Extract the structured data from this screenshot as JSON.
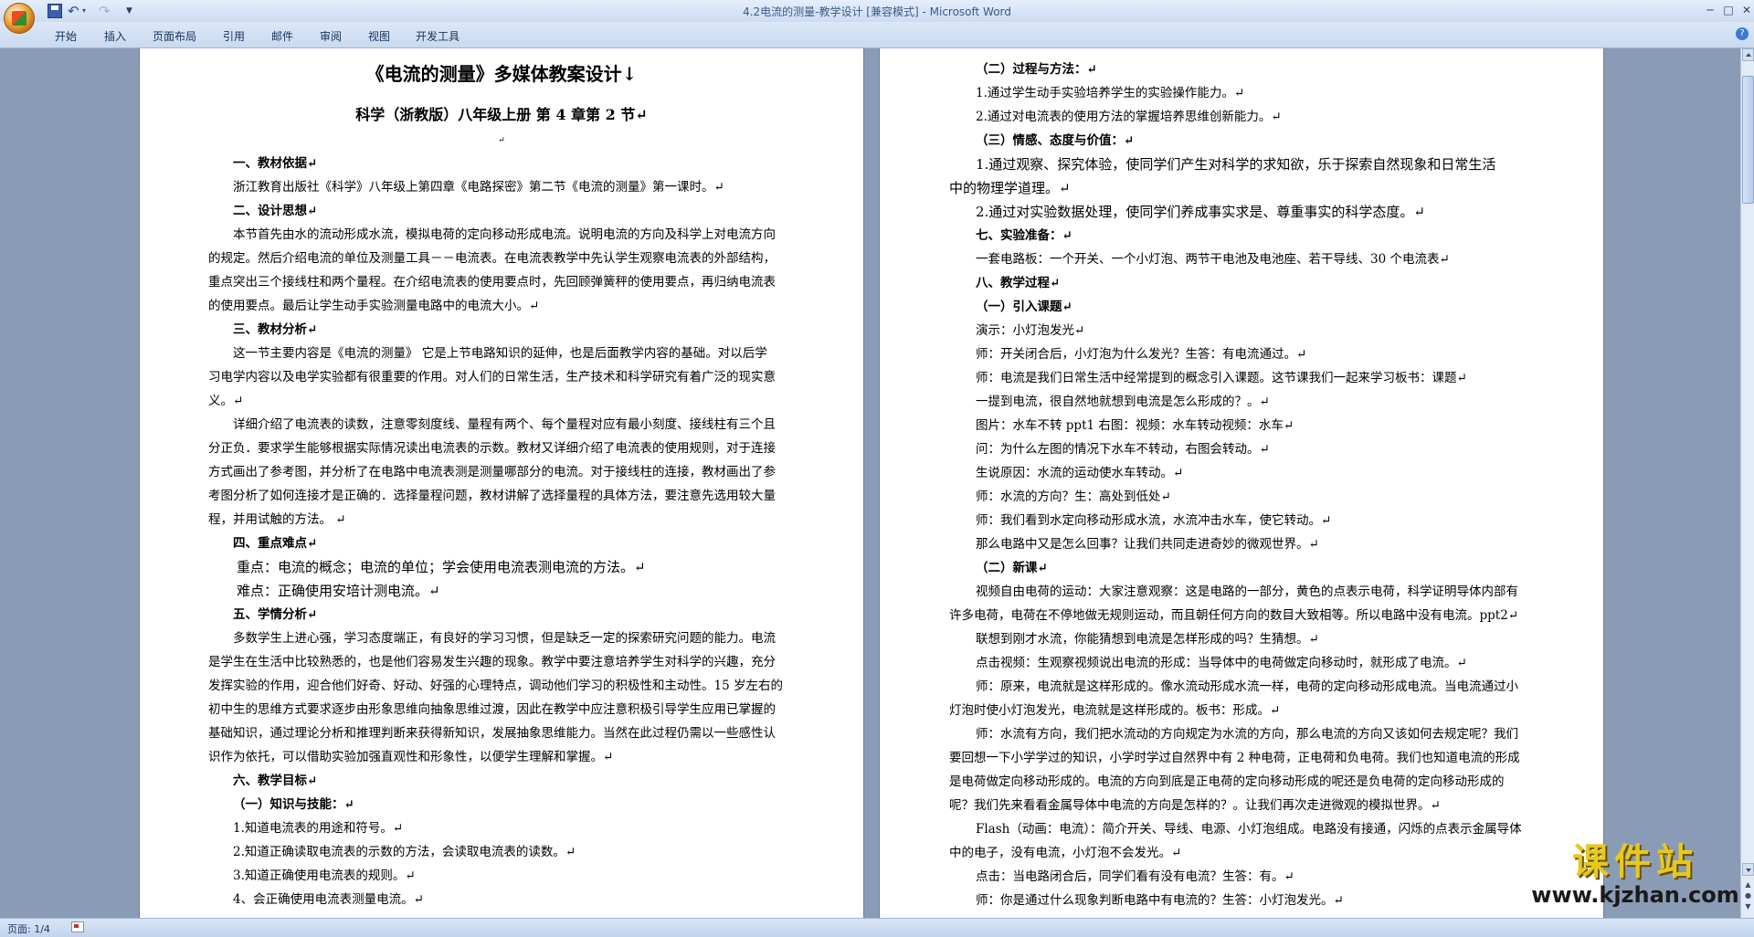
{
  "window": {
    "title": "4.2电流的测量-教学设计 [兼容模式] - Microsoft Word",
    "quick_access": {
      "save": "save-icon",
      "undo": "↶",
      "undo_drop": "▾",
      "redo": "↷",
      "customize": "▼"
    },
    "controls": {
      "minimize": "─",
      "maximize": "□",
      "close": "✕"
    }
  },
  "ribbon": {
    "tabs": [
      "开始",
      "插入",
      "页面布局",
      "引用",
      "邮件",
      "审阅",
      "视图",
      "开发工具"
    ],
    "help": "?"
  },
  "document": {
    "page1": {
      "title": "《电流的测量》多媒体教案设计↓",
      "subtitle": "科学（浙教版）八年级上册  第 4 章第 2 节↵",
      "mark": "↵",
      "s1_head": "一、教材依据↵",
      "s1_l1": "浙江教育出版社《科学》八年级上第四章《电路探密》第二节《电流的测量》第一课时。↵",
      "s2_head": "二、设计思想↵",
      "s2_l1": "本节首先由水的流动形成水流，模拟电荷的定向移动形成电流。说明电流的方向及科学上对电流方向",
      "s2_l2": "的规定。然后介绍电流的单位及测量工具－－电流表。在电流表教学中先认学生观察电流表的外部结构，",
      "s2_l3": "重点突出三个接线柱和两个量程。在介绍电流表的使用要点时，先回顾弹簧秤的使用要点，再归纳电流表",
      "s2_l4": "的使用要点。最后让学生动手实验测量电路中的电流大小。↵",
      "s3_head": "三、教材分析↵",
      "s3_l1": "这一节主要内容是《电流的测量》 它是上节电路知识的延伸，也是后面教学内容的基础。对以后学",
      "s3_l2": "习电学内容以及电学实验都有很重要的作用。对人们的日常生活，生产技术和科学研究有着广泛的现实意",
      "s3_l3": "义。↵",
      "s3_l4": "详细介绍了电流表的读数，注意零刻度线、量程有两个、每个量程对应有最小刻度、接线柱有三个且",
      "s3_l5": "分正负．要求学生能够根据实际情况读出电流表的示数。教材又详细介绍了电流表的使用规则，对于连接",
      "s3_l6": "方式画出了参考图，并分析了在电路中电流表测是测量哪部分的电流。对于接线柱的连接，教材画出了参",
      "s3_l7": "考图分析了如何连接才是正确的．选择量程问题，教材讲解了选择量程的具体方法，要注意先选用较大量",
      "s3_l8": "程，并用试触的方法。 ↵",
      "s4_head": "四、重点难点↵",
      "s4_l1": "重点：电流的概念；电流的单位；学会使用电流表测电流的方法。↵",
      "s4_l2": "难点：正确使用安培计测电流。↵",
      "s5_head": "五、学情分析↵",
      "s5_l1": "多数学生上进心强，学习态度端正，有良好的学习习惯，但是缺乏一定的探索研究问题的能力。电流",
      "s5_l2": "是学生在生活中比较熟悉的，也是他们容易发生兴趣的现象。教学中要注意培养学生对科学的兴趣，充分",
      "s5_l3": "发挥实验的作用，迎合他们好奇、好动、好强的心理特点，调动他们学习的积极性和主动性。15 岁左右的",
      "s5_l4": "初中生的思维方式要求逐步由形象思维向抽象思维过渡，因此在教学中应注意积极引导学生应用已掌握的",
      "s5_l5": "基础知识，通过理论分析和推理判断来获得新知识，发展抽象思维能力。当然在此过程仍需以一些感性认",
      "s5_l6": "识作为依托，可以借助实验加强直观性和形象性，以便学生理解和掌握。↵",
      "s6_head": "六、教学目标↵",
      "s6_sub": "（一）知识与技能：↵",
      "s6_l1": "1.知道电流表的用途和符号。↵",
      "s6_l2": "2.知道正确读取电流表的示数的方法，会读取电流表的读数。↵",
      "s6_l3": "3.知道正确使用电流表的规则。↵",
      "s6_l4": "4、会正确使用电流表测量电流。↵"
    },
    "page2": {
      "g2_head": "（二）过程与方法：↵",
      "g2_l1": "1.通过学生动手实验培养学生的实验操作能力。↵",
      "g2_l2": "2.通过对电流表的使用方法的掌握培养思维创新能力。↵",
      "g3_head": "（三）情感、态度与价值：↵",
      "g3_l1": "1.通过观察、探究体验，使同学们产生对科学的求知欲，乐于探索自然现象和日常生活",
      "g3_l2": "中的物理学道理。↵",
      "g3_l3": "2.通过对实验数据处理，使同学们养成事实求是、尊重事实的科学态度。↵",
      "s7_head": "七、实验准备：↵",
      "s7_l1": "一套电路板：一个开关、一个小灯泡、两节干电池及电池座、若干导线、30 个电流表↵",
      "s8_head": "八、教学过程↵",
      "s8_sub1": "（一）引入课题↵",
      "p1": "演示：小灯泡发光↵",
      "p2": "师：开关闭合后，小灯泡为什么发光？生答：有电流通过。↵",
      "p3": "师：电流是我们日常生活中经常提到的概念引入课题。这节课我们一起来学习板书：课题↵",
      "p4": "一提到电流，很自然地就想到电流是怎么形成的？。↵",
      "p5": "图片：水车不转 ppt1     右图：视频：水车转动视频：水车↵",
      "p6": "问：为什么左图的情况下水车不转动，右图会转动。↵",
      "p7": "生说原因：水流的运动使水车转动。↵",
      "p8": "师：水流的方向？生：高处到低处↵",
      "p9": "师：我们看到水定向移动形成水流，水流冲击水车，使它转动。↵",
      "p10": "那么电路中又是怎么回事？让我们共同走进奇妙的微观世界。↵",
      "s8_sub2": "（二）新课↵",
      "n1": "视频自由电荷的运动：大家注意观察：这是电路的一部分，黄色的点表示电荷，科学证明导体内部有",
      "n2": "许多电荷，电荷在不停地做无规则运动，而且朝任何方向的数目大致相等。所以电路中没有电流。ppt2↵",
      "n3": "联想到刚才水流，你能猜想到电流是怎样形成的吗？生猜想。↵",
      "n4": "点击视频：生观察视频说出电流的形成：当导体中的电荷做定向移动时，就形成了电流。↵",
      "n5": "师：原来，电流就是这样形成的。像水流动形成水流一样，电荷的定向移动形成电流。当电流通过小",
      "n6": "灯泡时使小灯泡发光，电流就是这样形成的。板书：形成。↵",
      "n7": "师：水流有方向，我们把水流动的方向规定为水流的方向，那么电流的方向又该如何去规定呢？我们",
      "n8": "要回想一下小学学过的知识，小学时学过自然界中有 2 种电荷，正电荷和负电荷。我们也知道电流的形成",
      "n9": "是电荷做定向移动形成的。电流的方向到底是正电荷的定向移动形成的呢还是负电荷的定向移动形成的",
      "n10": "呢？我们先来看看金属导体中电流的方向是怎样的？。让我们再次走进微观的模拟世界。↵",
      "n11": "Flash（动画：电流）：简介开关、导线、电源、小灯泡组成。电路没有接通，闪烁的点表示金属导体",
      "n12": "中的电子，没有电流，小灯泡不会发光。↵",
      "n13": "点击：当电路闭合后，同学们看有没有电流？生答：有。↵",
      "n14": "师：你是通过什么现象判断电路中有电流的？生答：小灯泡发光。↵"
    }
  },
  "status": {
    "page": "页面: 1/4"
  },
  "watermark": {
    "title": "课件站",
    "url": "www.kjzhan.com"
  }
}
